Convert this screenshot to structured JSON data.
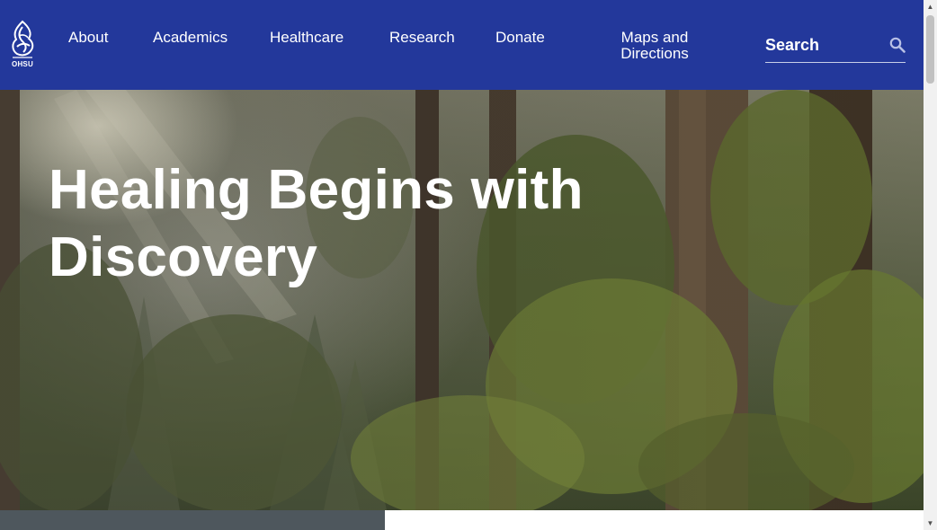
{
  "brand": {
    "name": "OHSU"
  },
  "nav": {
    "items": [
      {
        "label": "About"
      },
      {
        "label": "Academics"
      },
      {
        "label": "Healthcare"
      },
      {
        "label": "Research"
      },
      {
        "label": "Donate"
      },
      {
        "label": "Maps and Directions"
      }
    ]
  },
  "search": {
    "placeholder": "Search",
    "icon": "search-icon"
  },
  "hero": {
    "title": "Healing Begins with Discovery"
  },
  "colors": {
    "header_bg": "#23389b",
    "footer_strip_dark": "#4e575d"
  }
}
